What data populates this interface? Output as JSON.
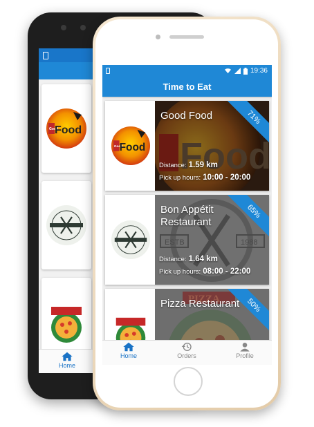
{
  "status_bar": {
    "time": "19:36",
    "icons": [
      "sim-icon",
      "wifi-icon",
      "signal-icon",
      "battery-icon"
    ]
  },
  "app_bar": {
    "title": "Time to Eat"
  },
  "restaurants": [
    {
      "name": "Good Food",
      "logo": "good-food-logo",
      "logo_text": "Food",
      "logo_small": "Good",
      "discount": "71%",
      "distance_label": "Distance:",
      "distance": "1.59 km",
      "hours_label": "Pick up hours:",
      "hours": "10:00 - 20:00"
    },
    {
      "name": "Bon Appétit Restaurant",
      "logo": "street-cafe-logo",
      "logo_text": "STREET CAFE",
      "logo_year": "1988",
      "logo_estb": "ESTB",
      "discount": "65%",
      "distance_label": "Distance:",
      "distance": "1.64 km",
      "hours_label": "Pick up hours:",
      "hours": "08:00 - 22:00"
    },
    {
      "name": "Pizza Restaurant",
      "logo": "pizza-logo",
      "logo_text": "PIZZA",
      "discount": "50%"
    }
  ],
  "tabs": [
    {
      "label": "Home",
      "icon": "home-icon",
      "active": true
    },
    {
      "label": "Orders",
      "icon": "history-icon",
      "active": false
    },
    {
      "label": "Profile",
      "icon": "person-icon",
      "active": false
    }
  ],
  "back_phone": {
    "tab_label": "Home"
  },
  "colors": {
    "primary": "#1f88d6",
    "status": "#1976c9",
    "active_tab": "#1a73c6"
  }
}
